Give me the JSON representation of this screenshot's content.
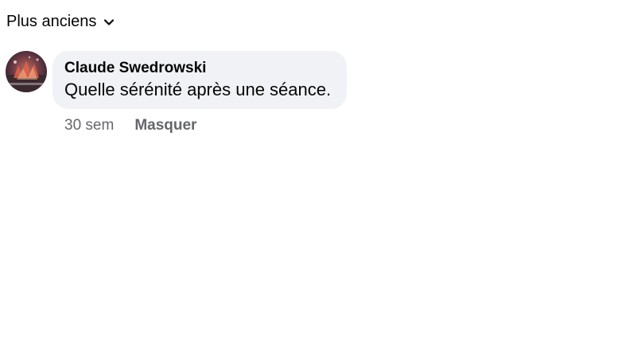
{
  "sort": {
    "label": "Plus anciens",
    "icon": "chevron-down-icon"
  },
  "comment": {
    "avatar_icon": "user-avatar",
    "author": "Claude Swedrowski",
    "text": "Quelle sérénité après une séance.",
    "time": "30 sem",
    "hide_label": "Masquer"
  },
  "colors": {
    "bubble_bg": "#f0f2f5",
    "text": "#050505",
    "secondary_text": "#65676b"
  }
}
